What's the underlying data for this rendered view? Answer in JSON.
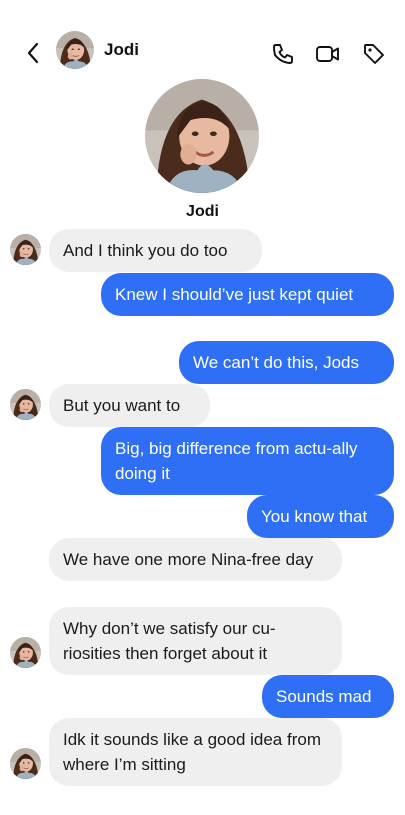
{
  "header": {
    "contact_name": "Jodi",
    "icons": [
      "chevron-left-icon",
      "phone-icon",
      "video-icon",
      "tag-icon"
    ]
  },
  "profile": {
    "name": "Jodi"
  },
  "messages": [
    {
      "from": "them",
      "text": "And I think you do too"
    },
    {
      "from": "me",
      "text": "Knew I should’ve just kept quiet"
    },
    {
      "from": "me",
      "text": "We can’t do this, Jods"
    },
    {
      "from": "them",
      "text": "But you want to"
    },
    {
      "from": "me",
      "text": "Big, big difference from actu-ally doing it"
    },
    {
      "from": "me",
      "text": "You know that"
    },
    {
      "from": "them",
      "text": "We have one more Nina-free day"
    },
    {
      "from": "them",
      "text": "Why don’t we satisfy our cu-riosities then forget about it"
    },
    {
      "from": "me",
      "text": "Sounds mad"
    },
    {
      "from": "them",
      "text": "Idk it sounds like a good idea from where I’m sitting"
    }
  ],
  "colors": {
    "outgoing_bubble": "#2f6ff5",
    "incoming_bubble": "#efefef",
    "background": "#ffffff"
  }
}
